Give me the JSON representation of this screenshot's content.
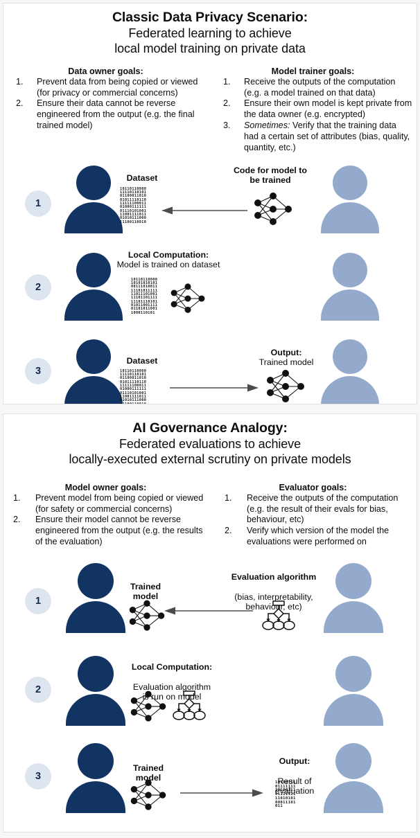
{
  "panels": [
    {
      "id": "classic-data-privacy",
      "heading_main": "Classic Data Privacy Scenario:",
      "heading_sub_line1": "Federated learning to achieve",
      "heading_sub_line2": "local model training on private data",
      "goals_left_title": "Data owner goals:",
      "goals_left": [
        {
          "num": "1.",
          "text": "Prevent data from being copied or viewed (for privacy or commercial concerns)"
        },
        {
          "num": "2.",
          "text": "Ensure their data cannot be reverse engineered from the output (e.g. the final trained model)"
        }
      ],
      "goals_right_title": "Model trainer goals:",
      "goals_right": [
        {
          "num": "1.",
          "text": "Receive the outputs of the computation (e.g. a model trained on that data)"
        },
        {
          "num": "2.",
          "text": "Ensure their own model is kept private from the data owner (e.g. encrypted)"
        },
        {
          "num": "3.",
          "emph": "Sometimes:",
          "text": " Verify that the training data had a certain set of attributes (bias, quality, quantity, etc.)"
        }
      ],
      "steps": [
        {
          "badge": "1",
          "left_caption_bold": "Dataset",
          "left_caption_norm": "",
          "right_caption_bold": "Code for model to",
          "right_caption_norm": "be trained",
          "arrow_direction": "left"
        },
        {
          "badge": "2",
          "left_caption_bold": "Local Computation:",
          "left_caption_norm": "Model is trained on dataset",
          "right_caption_bold": "",
          "right_caption_norm": "",
          "arrow_direction": "none"
        },
        {
          "badge": "3",
          "left_caption_bold": "Dataset",
          "left_caption_norm": "",
          "right_caption_bold": "Output:",
          "right_caption_norm": "Trained model",
          "arrow_direction": "right"
        }
      ]
    },
    {
      "id": "ai-governance-analogy",
      "heading_main": "AI Governance Analogy:",
      "heading_sub_line1": "Federated evaluations to achieve",
      "heading_sub_line2": "locally-executed external scrutiny on private models",
      "goals_left_title": "Model owner goals:",
      "goals_left": [
        {
          "num": "1.",
          "text": "Prevent model from being copied or viewed (for safety or commercial concerns)"
        },
        {
          "num": "2.",
          "text": "Ensure their model cannot be reverse engineered from the output (e.g. the results of the evaluation)"
        }
      ],
      "goals_right_title": "Evaluator goals:",
      "goals_right": [
        {
          "num": "1.",
          "text": "Receive the outputs of the computation (e.g. the result of their evals for bias, behaviour, etc)"
        },
        {
          "num": "2.",
          "text": "Verify which version of the model the evaluations were performed on"
        }
      ],
      "steps": [
        {
          "badge": "1",
          "left_caption_bold": "Trained\nmodel",
          "left_caption_norm": "",
          "right_caption_bold": "Evaluation algorithm",
          "right_caption_norm": "(bias, interpretability,\nbehaviour, etc)",
          "arrow_direction": "left"
        },
        {
          "badge": "2",
          "left_caption_bold": "Local Computation:",
          "left_caption_norm": "Evaluation algorithm\nis run on model",
          "right_caption_bold": "",
          "right_caption_norm": "",
          "arrow_direction": "none"
        },
        {
          "badge": "3",
          "left_caption_bold": "Trained\nmodel",
          "left_caption_norm": "",
          "right_caption_bold": "Output:",
          "right_caption_norm": "Result of\nevaluation",
          "arrow_direction": "right"
        }
      ]
    }
  ],
  "binary_blocks": {
    "large": "10110110000111101101010110001101001011110110111111000110100011111101110101001110011110110101011100011100110010",
    "medium": "1011011000010101010101001110100111110101111111011101001111011011111110111010101011001111011010110011000110101",
    "small": "101001110111111110100111011111111101010100011101011"
  },
  "colors": {
    "person_dark": "#123462",
    "person_light": "#93aacd",
    "badge_bg": "#dde5f0",
    "badge_text": "#15284b",
    "arrow": "#4d4d4d",
    "panel_bg": "#ffffff",
    "page_bg": "#f7f7f7",
    "text": "#0d0d0d"
  },
  "icons": {
    "neural_network": "neural-network-icon",
    "flowchart": "flowchart-icon",
    "person": "person-icon",
    "binary_data": "binary-data-icon",
    "arrow_left": "arrow-left-icon",
    "arrow_right": "arrow-right-icon"
  }
}
